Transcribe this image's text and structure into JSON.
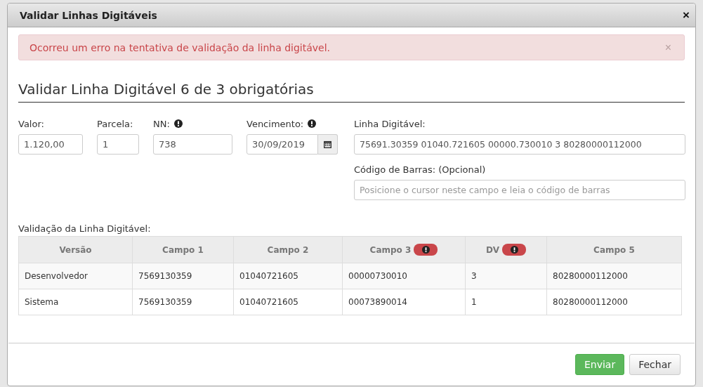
{
  "window": {
    "title": "Validar Linhas Digitáveis",
    "close": "×"
  },
  "alert": {
    "message": "Ocorreu um erro na tentativa de validação da linha digitável.",
    "close": "×"
  },
  "heading": "Validar Linha Digitável 6 de 3 obrigatórias",
  "fields": [
    {
      "kind": "text",
      "label": "Valor:",
      "value": "1.120,00",
      "warning": false
    },
    {
      "kind": "text",
      "label": "Parcela:",
      "value": "1",
      "warning": false
    },
    {
      "kind": "text",
      "label": "NN:",
      "value": "738",
      "warning": true
    },
    {
      "kind": "date",
      "label": "Vencimento:",
      "value": "30/09/2019",
      "warning": true
    }
  ],
  "linha_digitavel": {
    "label": "Linha Digitável:",
    "value": "75691.30359 01040.721605 00000.730010 3 80280000112000"
  },
  "codigo_barras": {
    "label": "Código de Barras: (Opcional)",
    "placeholder": "Posicione o cursor neste campo e leia o código de barras"
  },
  "table": {
    "caption": "Validação da Linha Digitável:",
    "columns": [
      {
        "label": "Versão",
        "warning": false
      },
      {
        "label": "Campo 1",
        "warning": false
      },
      {
        "label": "Campo 2",
        "warning": false
      },
      {
        "label": "Campo 3",
        "warning": true
      },
      {
        "label": "DV",
        "warning": true
      },
      {
        "label": "Campo 5",
        "warning": false
      }
    ],
    "rows": [
      [
        "Desenvolvedor",
        "7569130359",
        "01040721605",
        "00000730010",
        "3",
        "80280000112000"
      ],
      [
        "Sistema",
        "7569130359",
        "01040721605",
        "00073890014",
        "1",
        "80280000112000"
      ]
    ]
  },
  "buttons": [
    {
      "kind": "primary",
      "label": "Enviar"
    },
    {
      "kind": "default",
      "label": "Fechar"
    }
  ]
}
